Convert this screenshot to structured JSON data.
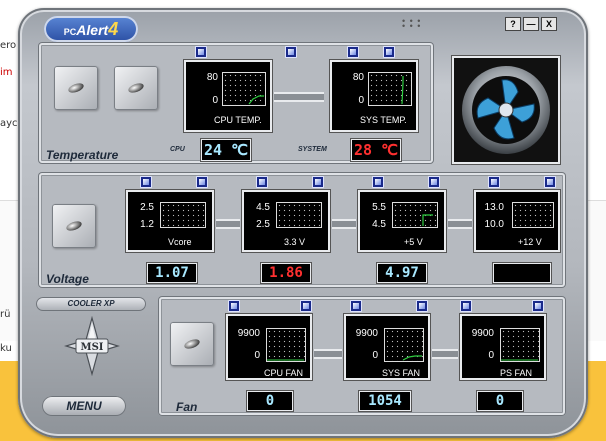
{
  "background": {
    "fragments": [
      "ero",
      "im",
      "ayc",
      "rü",
      "ku"
    ]
  },
  "app": {
    "logo_prefix": "PC",
    "logo_name": "Alert",
    "logo_version": "4",
    "window_buttons": {
      "help": "?",
      "minimize": "—",
      "close": "X"
    }
  },
  "temperature": {
    "label": "Temperature",
    "monitors": [
      {
        "name": "CPU TEMP.",
        "max": "80",
        "min": "0"
      },
      {
        "name": "SYS TEMP.",
        "max": "80",
        "min": "0"
      }
    ],
    "cpu_label": "CPU",
    "cpu_value": "24 ℃",
    "system_label": "SYSTEM",
    "system_value": "28 ℃"
  },
  "voltage": {
    "label": "Voltage",
    "monitors": [
      {
        "name": "Vcore",
        "high": "2.5",
        "low": "1.2",
        "reading": "1.07",
        "reading_color": "#a8e8ff"
      },
      {
        "name": "3.3 V",
        "high": "4.5",
        "low": "2.5",
        "reading": "1.86",
        "reading_color": "#ff3030"
      },
      {
        "name": "+5 V",
        "high": "5.5",
        "low": "4.5",
        "reading": "4.97",
        "reading_color": "#a8e8ff"
      },
      {
        "name": "+12 V",
        "high": "13.0",
        "low": "10.0",
        "reading": "",
        "reading_color": "#a8e8ff"
      }
    ]
  },
  "fan": {
    "label": "Fan",
    "monitors": [
      {
        "name": "CPU FAN",
        "max": "9900",
        "min": "0",
        "reading": "0"
      },
      {
        "name": "SYS FAN",
        "max": "9900",
        "min": "0",
        "reading": "1054"
      },
      {
        "name": "PS FAN",
        "max": "9900",
        "min": "0",
        "reading": "0"
      }
    ]
  },
  "controls": {
    "cooler_xp": "COOLER XP",
    "msi_logo": "MSI",
    "menu": "MENU"
  },
  "colors": {
    "trace_green": "#2ecc40",
    "lcd_cyan": "#a8e8ff",
    "lcd_red": "#ff3030",
    "fan_blue": "#3da0d8"
  }
}
